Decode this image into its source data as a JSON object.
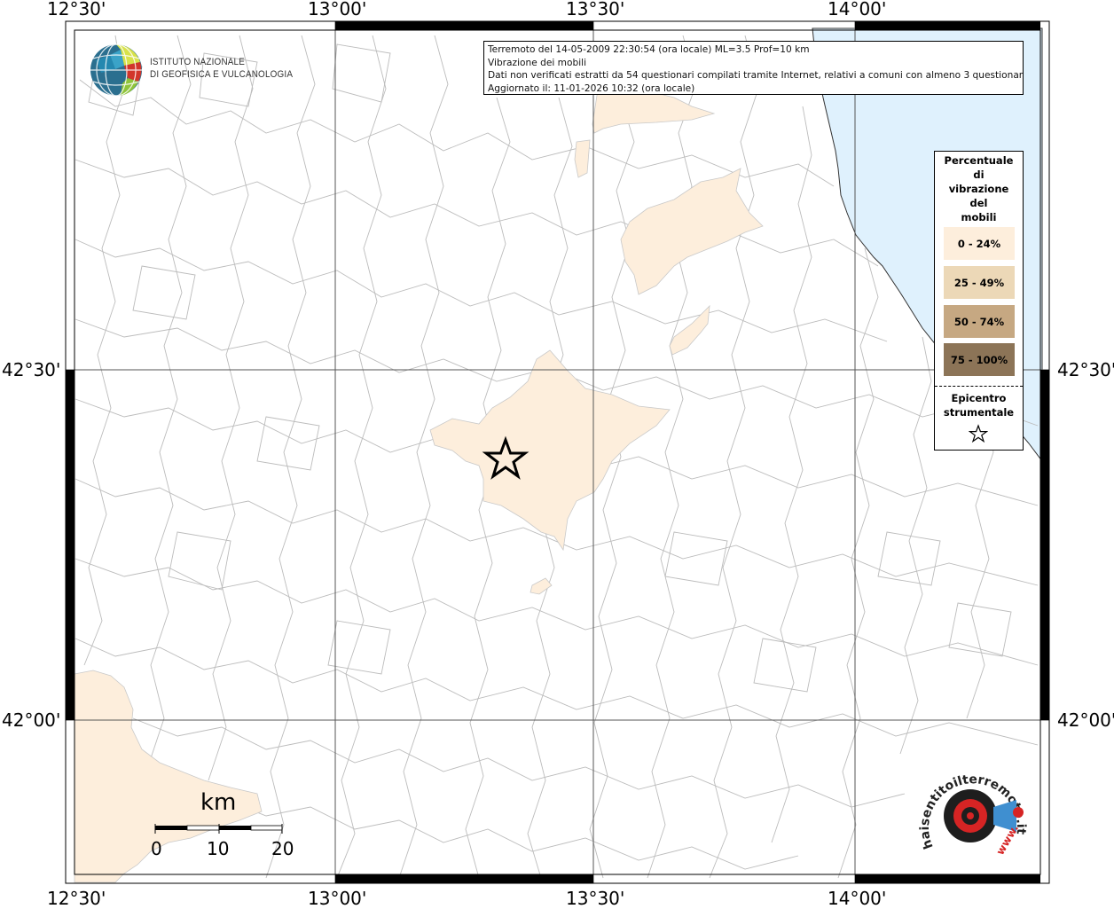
{
  "map": {
    "lon_labels": [
      "12°30'",
      "13°00'",
      "13°30'",
      "14°00'"
    ],
    "lat_labels": [
      "42°30'",
      "42°00'"
    ]
  },
  "info": {
    "line1": "Terremoto del 14-05-2009 22:30:54 (ora locale) ML=3.5 Prof=10 km",
    "line2": "Vibrazione dei mobili",
    "line3": "Dati non verificati estratti da 54 questionari compilati tramite Internet, relativi a comuni con almeno 3 questionari.",
    "line4": "Aggiornato il: 11-01-2026 10:32 (ora locale)"
  },
  "legend": {
    "title_lines": [
      "Percentuale",
      "di",
      "vibrazione",
      "del",
      "mobili"
    ],
    "classes": [
      {
        "label": "0 - 24%",
        "color": "#fdeedc"
      },
      {
        "label": "25 - 49%",
        "color": "#ecd8b7"
      },
      {
        "label": "50 - 74%",
        "color": "#c6a882"
      },
      {
        "label": "75 - 100%",
        "color": "#8c7457"
      }
    ],
    "epicenter_lines": [
      "Epicentro",
      "strumentale"
    ]
  },
  "logos": {
    "ingv_line1": "ISTITUTO NAZIONALE",
    "ingv_line2": "DI GEOFISICA E VULCANOLOGIA",
    "hst_text": "haisentitoilterremoto.it",
    "hst_url": "www."
  },
  "scale": {
    "unit": "km",
    "labels": [
      "0",
      "10",
      "20"
    ]
  },
  "colors": {
    "sea": "#dff1fd",
    "felt_low": "#fdeedc",
    "boundary": "#b8b8b8"
  }
}
